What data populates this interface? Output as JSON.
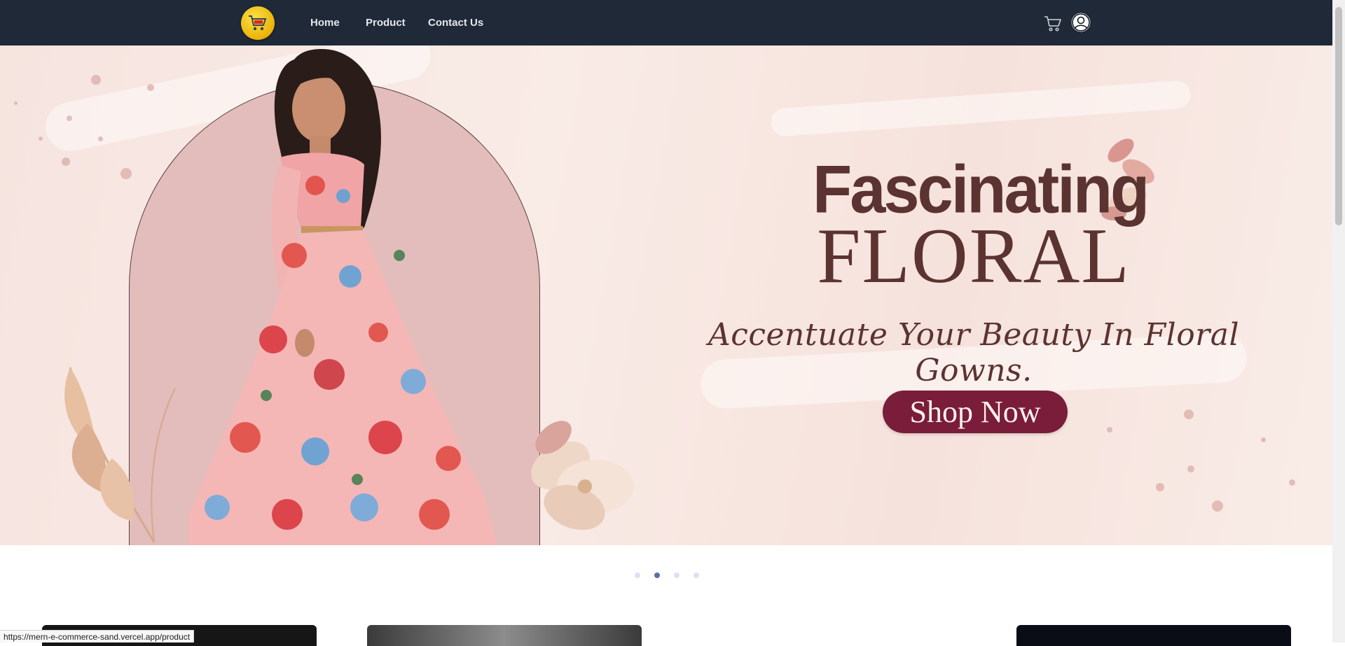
{
  "navbar": {
    "logo_icon": "shopping-cart-logo-icon",
    "links": [
      {
        "label": "Home"
      },
      {
        "label": "Product"
      },
      {
        "label": "Contact Us"
      }
    ],
    "cart_icon": "cart-icon",
    "user_icon": "user-circle-icon"
  },
  "hero": {
    "headline_line1": "Fascinating",
    "headline_line2": "FLORAL",
    "tagline": "Accentuate Your Beauty In Floral Gowns.",
    "cta_label": "Shop Now",
    "colors": {
      "background": "#f6e4df",
      "arch": "#e3bcbc",
      "headline": "#5b3330",
      "cta": "#7a1d3a"
    }
  },
  "carousel": {
    "slide_count": 4,
    "active_index": 1
  },
  "status_bar": {
    "url": "https://mern-e-commerce-sand.vercel.app/product"
  }
}
